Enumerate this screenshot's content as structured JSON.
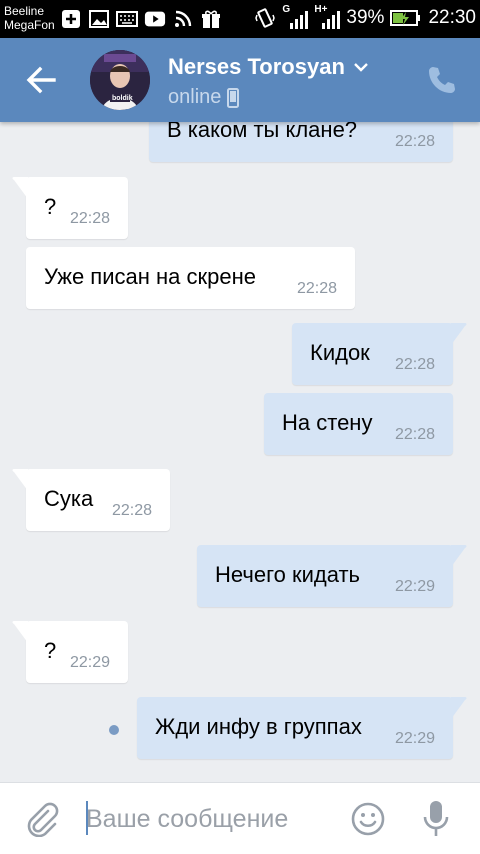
{
  "status_bar": {
    "carrier_1": "Beeline",
    "carrier_2": "MegaFon",
    "network_1": "G",
    "network_2": "H+",
    "battery": "39%",
    "time": "22:30"
  },
  "header": {
    "contact_name": "Nerses Torosyan",
    "status": "online",
    "avatar_caption": "boldik"
  },
  "messages": [
    {
      "direction": "out",
      "text": "В каком ты клане?",
      "time": "22:28"
    },
    {
      "direction": "in",
      "text": "?",
      "time": "22:28"
    },
    {
      "direction": "in",
      "text": "Уже писан на скрене",
      "time": "22:28"
    },
    {
      "direction": "out",
      "text": "Кидок",
      "time": "22:28"
    },
    {
      "direction": "out",
      "text": "На стену",
      "time": "22:28"
    },
    {
      "direction": "in",
      "text": "Сука",
      "time": "22:28"
    },
    {
      "direction": "out",
      "text": "Нечего кидать",
      "time": "22:29"
    },
    {
      "direction": "in",
      "text": "?",
      "time": "22:29"
    },
    {
      "direction": "out",
      "text": "Жди инфу в группах",
      "time": "22:29",
      "unread": true
    }
  ],
  "input": {
    "placeholder": "Ваше сообщение"
  },
  "colors": {
    "header": "#5b88bd",
    "chat_bg": "#eceef1",
    "bubble_in": "#ffffff",
    "bubble_out": "#d6e4f5",
    "time": "#8e98a3"
  },
  "icons": [
    "back-arrow-icon",
    "chevron-down-icon",
    "mobile-phone-icon",
    "phone-call-icon",
    "paperclip-icon",
    "emoji-icon",
    "microphone-icon"
  ]
}
